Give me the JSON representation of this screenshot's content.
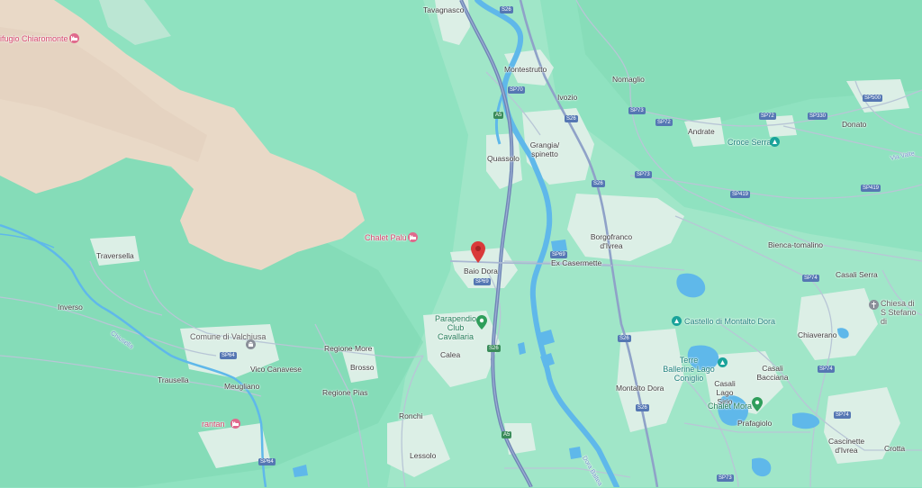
{
  "map": {
    "colors": {
      "land": "#8fe2c0",
      "terrain": "#e8d8c6",
      "water": "#5fb8ea",
      "highway": "#7e93be",
      "road": "#b7c3d4",
      "urban": "#dfeee6",
      "poi_red": "#d4446a",
      "poi_green": "#2f9e5b",
      "poi_teal": "#1aa39a",
      "marker": "#d93a3a"
    },
    "places": [
      {
        "id": "tavagnasco",
        "name": "Tavagnasco"
      },
      {
        "id": "montestrutto",
        "name": "Montestrutto"
      },
      {
        "id": "nomaglio",
        "name": "Nomaglio"
      },
      {
        "id": "ivozio",
        "name": "Ivozio"
      },
      {
        "id": "andrate",
        "name": "Andrate"
      },
      {
        "id": "donato",
        "name": "Donato"
      },
      {
        "id": "quassolo",
        "name": "Quassolo"
      },
      {
        "id": "grangia",
        "name": "Grangia/ spinetto"
      },
      {
        "id": "borgofranco",
        "name": "Borgofranco d'Ivrea"
      },
      {
        "id": "exc",
        "name": "Ex Casermette"
      },
      {
        "id": "baio",
        "name": "Baio Dora"
      },
      {
        "id": "bienca",
        "name": "Bienca-tomalino"
      },
      {
        "id": "casaliserra",
        "name": "Casali Serra"
      },
      {
        "id": "traversella",
        "name": "Traversella"
      },
      {
        "id": "inverso",
        "name": "Inverso"
      },
      {
        "id": "vico",
        "name": "Vico Canavese"
      },
      {
        "id": "regmore",
        "name": "Regione More"
      },
      {
        "id": "brosso",
        "name": "Brosso"
      },
      {
        "id": "regpias",
        "name": "Regione Pias"
      },
      {
        "id": "trausella",
        "name": "Trausella"
      },
      {
        "id": "meugliano",
        "name": "Meugliano"
      },
      {
        "id": "calea",
        "name": "Calea"
      },
      {
        "id": "ronchi",
        "name": "Ronchi"
      },
      {
        "id": "lessolo",
        "name": "Lessolo"
      },
      {
        "id": "chiaverano",
        "name": "Chiaverano"
      },
      {
        "id": "casalibacciana",
        "name": "Casali Bacciana"
      },
      {
        "id": "casalilago",
        "name": "Casali Lago Sirio"
      },
      {
        "id": "montalto",
        "name": "Montalto Dora"
      },
      {
        "id": "prafagiolo",
        "name": "Prafagiolo"
      },
      {
        "id": "cascinette",
        "name": "Cascinette d'Ivrea"
      },
      {
        "id": "crotta",
        "name": "Crotta"
      }
    ],
    "pois": {
      "rifugio": "ifugio Chiaromonte",
      "chalet_palu": "Chalet Palù",
      "croce_serra": "Croce Serra",
      "parapendio": "Parapendio Club Cavallaria",
      "comune_valchiusa": "Comune di Valchiusa",
      "castello": "Castello di Montalto Dora",
      "terre_ballerine": "Terre Ballerine Lago Coniglio",
      "chalet_mora": "Chalet Mora",
      "chiesa": "Chiesa di S Stefano di",
      "rantan": "rantan"
    },
    "roads": {
      "s26": "S26",
      "sp70": "SP70",
      "a5": "A5",
      "sp73": "SP73",
      "sp72": "SP72",
      "sp330": "SP330",
      "sp500": "SP500",
      "sp419": "SP419",
      "sp69": "SP69",
      "sp74": "SP74",
      "sp64": "SP64",
      "via_valtel": "Via Valte"
    },
    "rivers": {
      "chiusella": "Chiusella",
      "dora": "Dora Baltea"
    },
    "selected_marker": {
      "name": "Baio Dora"
    }
  }
}
